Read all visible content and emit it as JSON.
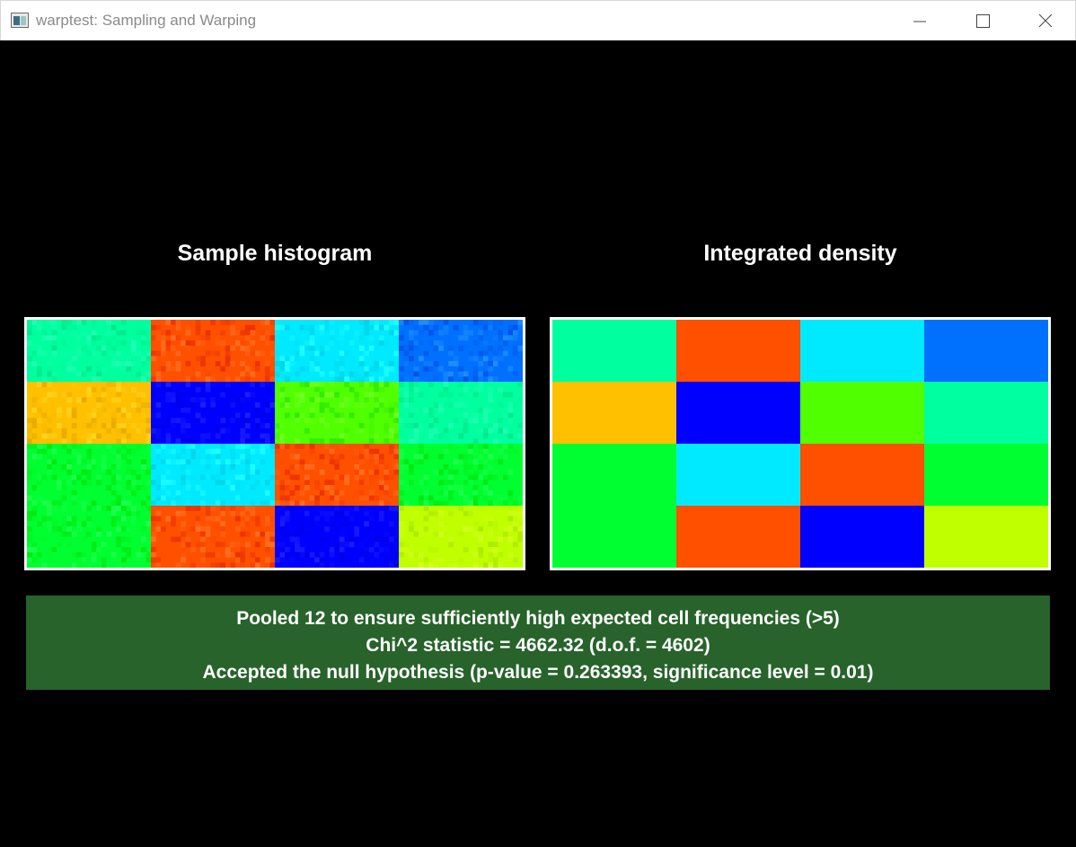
{
  "window": {
    "title": "warptest: Sampling and Warping"
  },
  "panels": {
    "left_title": "Sample histogram",
    "right_title": "Integrated density"
  },
  "heatmap": {
    "rows": 4,
    "cols": 4,
    "cell_colors": [
      [
        "#00ff9f",
        "#ff5000",
        "#00eaff",
        "#0070ff"
      ],
      [
        "#ffc000",
        "#0000ff",
        "#50ff00",
        "#00ff9f"
      ],
      [
        "#00ff30",
        "#00eaff",
        "#ff5000",
        "#00ff30"
      ],
      [
        "#00ff30",
        "#ff5000",
        "#0000ff",
        "#c0ff00"
      ]
    ]
  },
  "results": {
    "line1": "Pooled 12 to ensure sufficiently high expected cell frequencies (>5)",
    "line2": "Chi^2 statistic = 4662.32 (d.o.f. = 4602)",
    "line3": "Accepted the null hypothesis (p-value = 0.263393, significance level = 0.01)"
  }
}
